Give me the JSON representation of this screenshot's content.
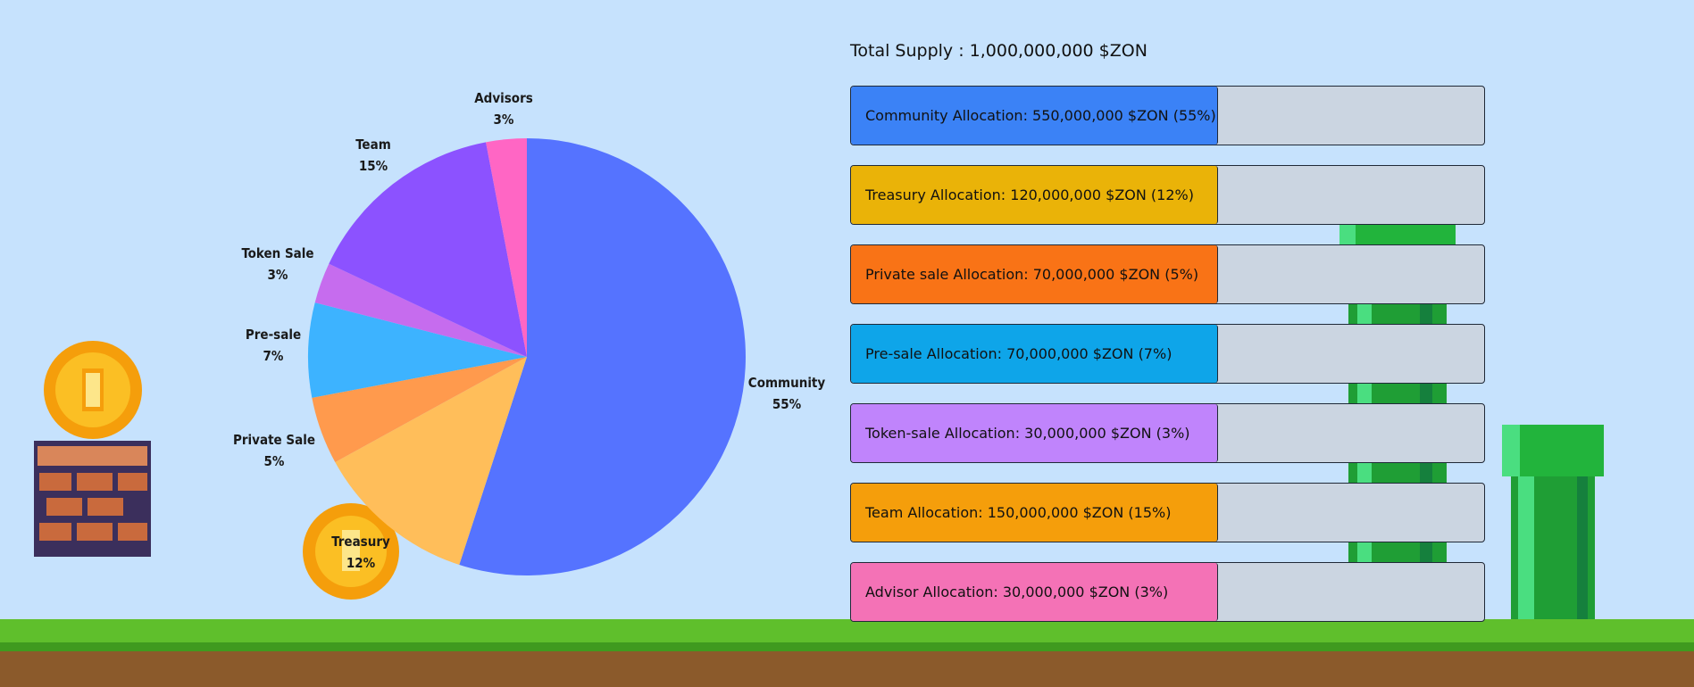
{
  "chart_data": [
    {
      "type": "pie",
      "slices": [
        {
          "label": "Community",
          "pct_label": "55%",
          "value": 55,
          "color": "#5573ff"
        },
        {
          "label": "Treasury",
          "pct_label": "12%",
          "value": 12,
          "color": "#ffbe5a"
        },
        {
          "label": "Private Sale",
          "pct_label": "5%",
          "value": 5,
          "color": "#ff9a4d"
        },
        {
          "label": "Pre-sale",
          "pct_label": "7%",
          "value": 7,
          "color": "#3db3ff"
        },
        {
          "label": "Token Sale",
          "pct_label": "3%",
          "value": 3,
          "color": "#c66cee"
        },
        {
          "label": "Team",
          "pct_label": "15%",
          "value": 15,
          "color": "#8c52ff"
        },
        {
          "label": "Advisors",
          "pct_label": "3%",
          "value": 3,
          "color": "#ff66c4"
        }
      ]
    },
    {
      "type": "bar",
      "title": "Total Supply : 1,000,000,000 $ZON",
      "bars": [
        {
          "label": "Community Allocation: 550,000,000 $ZON (55%)",
          "value": 55,
          "color": "#3b82f6"
        },
        {
          "label": "Treasury Allocation: 120,000,000 $ZON (12%)",
          "value": 12,
          "color": "#eab308"
        },
        {
          "label": "Private sale Allocation: 70,000,000 $ZON (5%)",
          "value": 5,
          "color": "#f97316"
        },
        {
          "label": "Pre-sale Allocation: 70,000,000 $ZON (7%)",
          "value": 7,
          "color": "#0ea5e9"
        },
        {
          "label": "Token-sale Allocation: 30,000,000 $ZON (3%)",
          "value": 3,
          "color": "#c084fc"
        },
        {
          "label": "Team Allocation: 150,000,000 $ZON (15%)",
          "value": 15,
          "color": "#f59e0b"
        },
        {
          "label": "Advisor Allocation: 30,000,000 $ZON (3%)",
          "value": 30,
          "color": "#f472b6"
        }
      ]
    }
  ]
}
